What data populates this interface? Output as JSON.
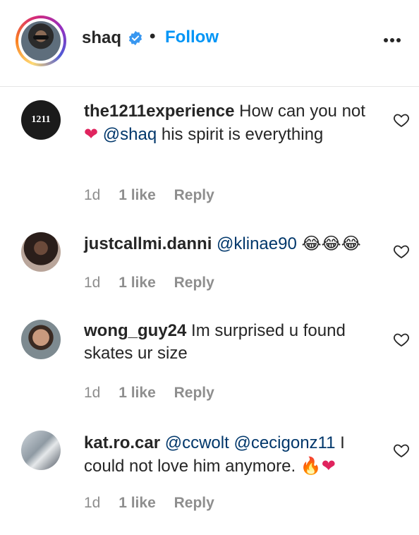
{
  "post": {
    "username": "shaq",
    "separator": "•",
    "follow_label": "Follow"
  },
  "comments": [
    {
      "username": "the1211experience",
      "avatar_text": "1211",
      "text_before": "How can you not",
      "emoji_1": "❤",
      "mention": "@shaq",
      "text_after": "his spirit is everything",
      "time": "1d",
      "likes": "1 like",
      "reply": "Reply"
    },
    {
      "username": "justcallmi.danni",
      "mention": "@klinae90",
      "emoji_1": "😂😂😂",
      "time": "1d",
      "likes": "1 like",
      "reply": "Reply"
    },
    {
      "username": "wong_guy24",
      "text": "Im surprised u found skates ur size",
      "time": "1d",
      "likes": "1 like",
      "reply": "Reply"
    },
    {
      "username": "kat.ro.car",
      "mention_1": "@ccwolt",
      "mention_2": "@cecigonz11",
      "text": "I could not love him anymore.",
      "emoji_1": "🔥",
      "emoji_2": "❤",
      "time": "1d",
      "likes": "1 like",
      "reply": "Reply"
    }
  ],
  "colors": {
    "link_blue": "#0095f6",
    "mention_blue": "#00376b",
    "meta_gray": "#8e8e8e",
    "text": "#262626"
  }
}
